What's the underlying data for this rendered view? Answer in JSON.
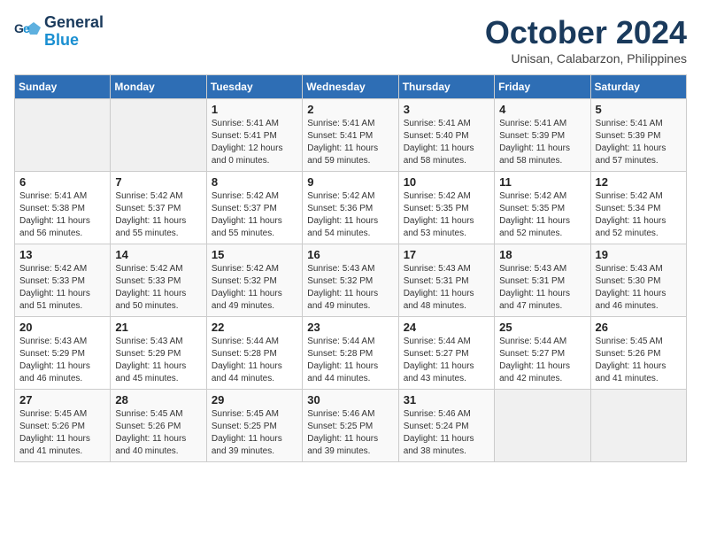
{
  "logo": {
    "line1": "General",
    "line2": "Blue"
  },
  "title": "October 2024",
  "subtitle": "Unisan, Calabarzon, Philippines",
  "days_header": [
    "Sunday",
    "Monday",
    "Tuesday",
    "Wednesday",
    "Thursday",
    "Friday",
    "Saturday"
  ],
  "weeks": [
    [
      {
        "day": "",
        "info": ""
      },
      {
        "day": "",
        "info": ""
      },
      {
        "day": "1",
        "info": "Sunrise: 5:41 AM\nSunset: 5:41 PM\nDaylight: 12 hours\nand 0 minutes."
      },
      {
        "day": "2",
        "info": "Sunrise: 5:41 AM\nSunset: 5:41 PM\nDaylight: 11 hours\nand 59 minutes."
      },
      {
        "day": "3",
        "info": "Sunrise: 5:41 AM\nSunset: 5:40 PM\nDaylight: 11 hours\nand 58 minutes."
      },
      {
        "day": "4",
        "info": "Sunrise: 5:41 AM\nSunset: 5:39 PM\nDaylight: 11 hours\nand 58 minutes."
      },
      {
        "day": "5",
        "info": "Sunrise: 5:41 AM\nSunset: 5:39 PM\nDaylight: 11 hours\nand 57 minutes."
      }
    ],
    [
      {
        "day": "6",
        "info": "Sunrise: 5:41 AM\nSunset: 5:38 PM\nDaylight: 11 hours\nand 56 minutes."
      },
      {
        "day": "7",
        "info": "Sunrise: 5:42 AM\nSunset: 5:37 PM\nDaylight: 11 hours\nand 55 minutes."
      },
      {
        "day": "8",
        "info": "Sunrise: 5:42 AM\nSunset: 5:37 PM\nDaylight: 11 hours\nand 55 minutes."
      },
      {
        "day": "9",
        "info": "Sunrise: 5:42 AM\nSunset: 5:36 PM\nDaylight: 11 hours\nand 54 minutes."
      },
      {
        "day": "10",
        "info": "Sunrise: 5:42 AM\nSunset: 5:35 PM\nDaylight: 11 hours\nand 53 minutes."
      },
      {
        "day": "11",
        "info": "Sunrise: 5:42 AM\nSunset: 5:35 PM\nDaylight: 11 hours\nand 52 minutes."
      },
      {
        "day": "12",
        "info": "Sunrise: 5:42 AM\nSunset: 5:34 PM\nDaylight: 11 hours\nand 52 minutes."
      }
    ],
    [
      {
        "day": "13",
        "info": "Sunrise: 5:42 AM\nSunset: 5:33 PM\nDaylight: 11 hours\nand 51 minutes."
      },
      {
        "day": "14",
        "info": "Sunrise: 5:42 AM\nSunset: 5:33 PM\nDaylight: 11 hours\nand 50 minutes."
      },
      {
        "day": "15",
        "info": "Sunrise: 5:42 AM\nSunset: 5:32 PM\nDaylight: 11 hours\nand 49 minutes."
      },
      {
        "day": "16",
        "info": "Sunrise: 5:43 AM\nSunset: 5:32 PM\nDaylight: 11 hours\nand 49 minutes."
      },
      {
        "day": "17",
        "info": "Sunrise: 5:43 AM\nSunset: 5:31 PM\nDaylight: 11 hours\nand 48 minutes."
      },
      {
        "day": "18",
        "info": "Sunrise: 5:43 AM\nSunset: 5:31 PM\nDaylight: 11 hours\nand 47 minutes."
      },
      {
        "day": "19",
        "info": "Sunrise: 5:43 AM\nSunset: 5:30 PM\nDaylight: 11 hours\nand 46 minutes."
      }
    ],
    [
      {
        "day": "20",
        "info": "Sunrise: 5:43 AM\nSunset: 5:29 PM\nDaylight: 11 hours\nand 46 minutes."
      },
      {
        "day": "21",
        "info": "Sunrise: 5:43 AM\nSunset: 5:29 PM\nDaylight: 11 hours\nand 45 minutes."
      },
      {
        "day": "22",
        "info": "Sunrise: 5:44 AM\nSunset: 5:28 PM\nDaylight: 11 hours\nand 44 minutes."
      },
      {
        "day": "23",
        "info": "Sunrise: 5:44 AM\nSunset: 5:28 PM\nDaylight: 11 hours\nand 44 minutes."
      },
      {
        "day": "24",
        "info": "Sunrise: 5:44 AM\nSunset: 5:27 PM\nDaylight: 11 hours\nand 43 minutes."
      },
      {
        "day": "25",
        "info": "Sunrise: 5:44 AM\nSunset: 5:27 PM\nDaylight: 11 hours\nand 42 minutes."
      },
      {
        "day": "26",
        "info": "Sunrise: 5:45 AM\nSunset: 5:26 PM\nDaylight: 11 hours\nand 41 minutes."
      }
    ],
    [
      {
        "day": "27",
        "info": "Sunrise: 5:45 AM\nSunset: 5:26 PM\nDaylight: 11 hours\nand 41 minutes."
      },
      {
        "day": "28",
        "info": "Sunrise: 5:45 AM\nSunset: 5:26 PM\nDaylight: 11 hours\nand 40 minutes."
      },
      {
        "day": "29",
        "info": "Sunrise: 5:45 AM\nSunset: 5:25 PM\nDaylight: 11 hours\nand 39 minutes."
      },
      {
        "day": "30",
        "info": "Sunrise: 5:46 AM\nSunset: 5:25 PM\nDaylight: 11 hours\nand 39 minutes."
      },
      {
        "day": "31",
        "info": "Sunrise: 5:46 AM\nSunset: 5:24 PM\nDaylight: 11 hours\nand 38 minutes."
      },
      {
        "day": "",
        "info": ""
      },
      {
        "day": "",
        "info": ""
      }
    ]
  ]
}
